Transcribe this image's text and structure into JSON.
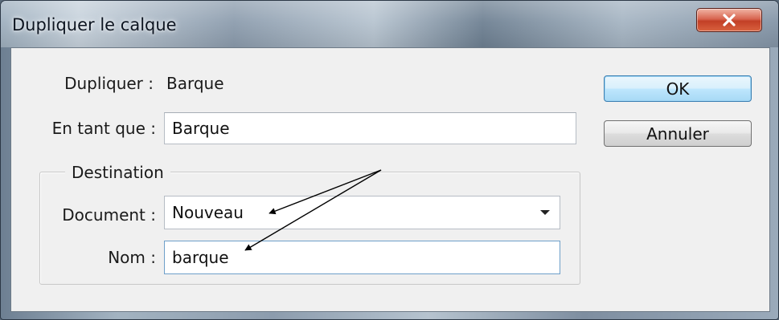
{
  "dialog": {
    "title": "Dupliquer le calque"
  },
  "form": {
    "duplicate_label": "Dupliquer :",
    "duplicate_value": "Barque",
    "as_label": "En tant que :",
    "as_value": "Barque"
  },
  "destination": {
    "legend": "Destination",
    "document_label": "Document :",
    "document_value": "Nouveau",
    "name_label": "Nom :",
    "name_value": "barque"
  },
  "buttons": {
    "ok": "OK",
    "cancel": "Annuler"
  },
  "icons": {
    "close": "close-icon",
    "dropdown": "chevron-down-icon",
    "annotation": "arrow-annotation"
  },
  "colors": {
    "close_button": "#c94a32",
    "default_button_border": "#3c7fb1",
    "dialog_background": "#f0f0f0"
  }
}
